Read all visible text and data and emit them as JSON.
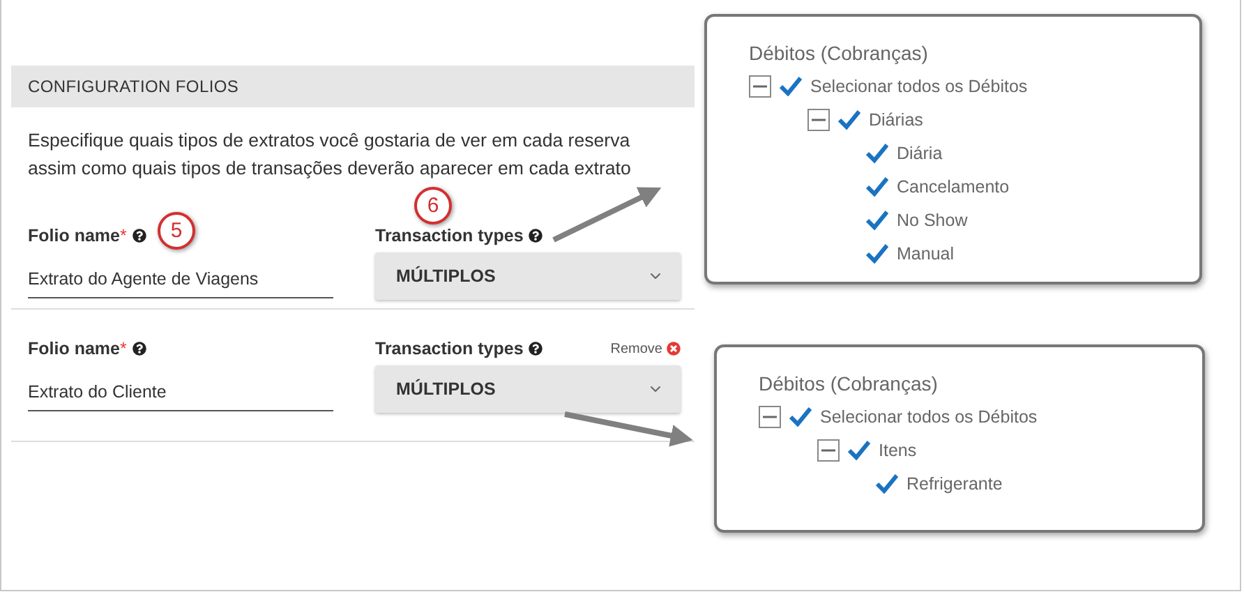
{
  "section": {
    "title": "CONFIGURATION FOLIOS",
    "description": "Especifique quais tipos de extratos você gostaria de ver em cada reserva assim como quais tipos de transações deverão aparecer em cada extrato"
  },
  "folios": [
    {
      "name_label": "Folio name",
      "required_mark": "*",
      "name_value": "Extrato do Agente de Viagens",
      "types_label": "Transaction types",
      "types_value": "MÚLTIPLOS"
    },
    {
      "name_label": "Folio name",
      "required_mark": "*",
      "name_value": "Extrato do Cliente",
      "types_label": "Transaction types",
      "types_value": "MÚLTIPLOS",
      "remove_label": "Remove"
    }
  ],
  "annotations": [
    {
      "number": "5"
    },
    {
      "number": "6"
    }
  ],
  "callouts": [
    {
      "title": "Débitos (Cobranças)",
      "nodes": [
        {
          "label": "Selecionar todos os Débitos",
          "checked": true,
          "expanded": true,
          "children": [
            {
              "label": "Diárias",
              "checked": true,
              "expanded": true,
              "children": [
                {
                  "label": "Diária",
                  "checked": true
                },
                {
                  "label": "Cancelamento",
                  "checked": true
                },
                {
                  "label": "No Show",
                  "checked": true
                },
                {
                  "label": "Manual",
                  "checked": true
                }
              ]
            }
          ]
        }
      ]
    },
    {
      "title": "Débitos (Cobranças)",
      "nodes": [
        {
          "label": "Selecionar todos os Débitos",
          "checked": true,
          "expanded": true,
          "children": [
            {
              "label": "Itens",
              "checked": true,
              "expanded": true,
              "children": [
                {
                  "label": "Refrigerante",
                  "checked": true
                }
              ]
            }
          ]
        }
      ]
    }
  ]
}
